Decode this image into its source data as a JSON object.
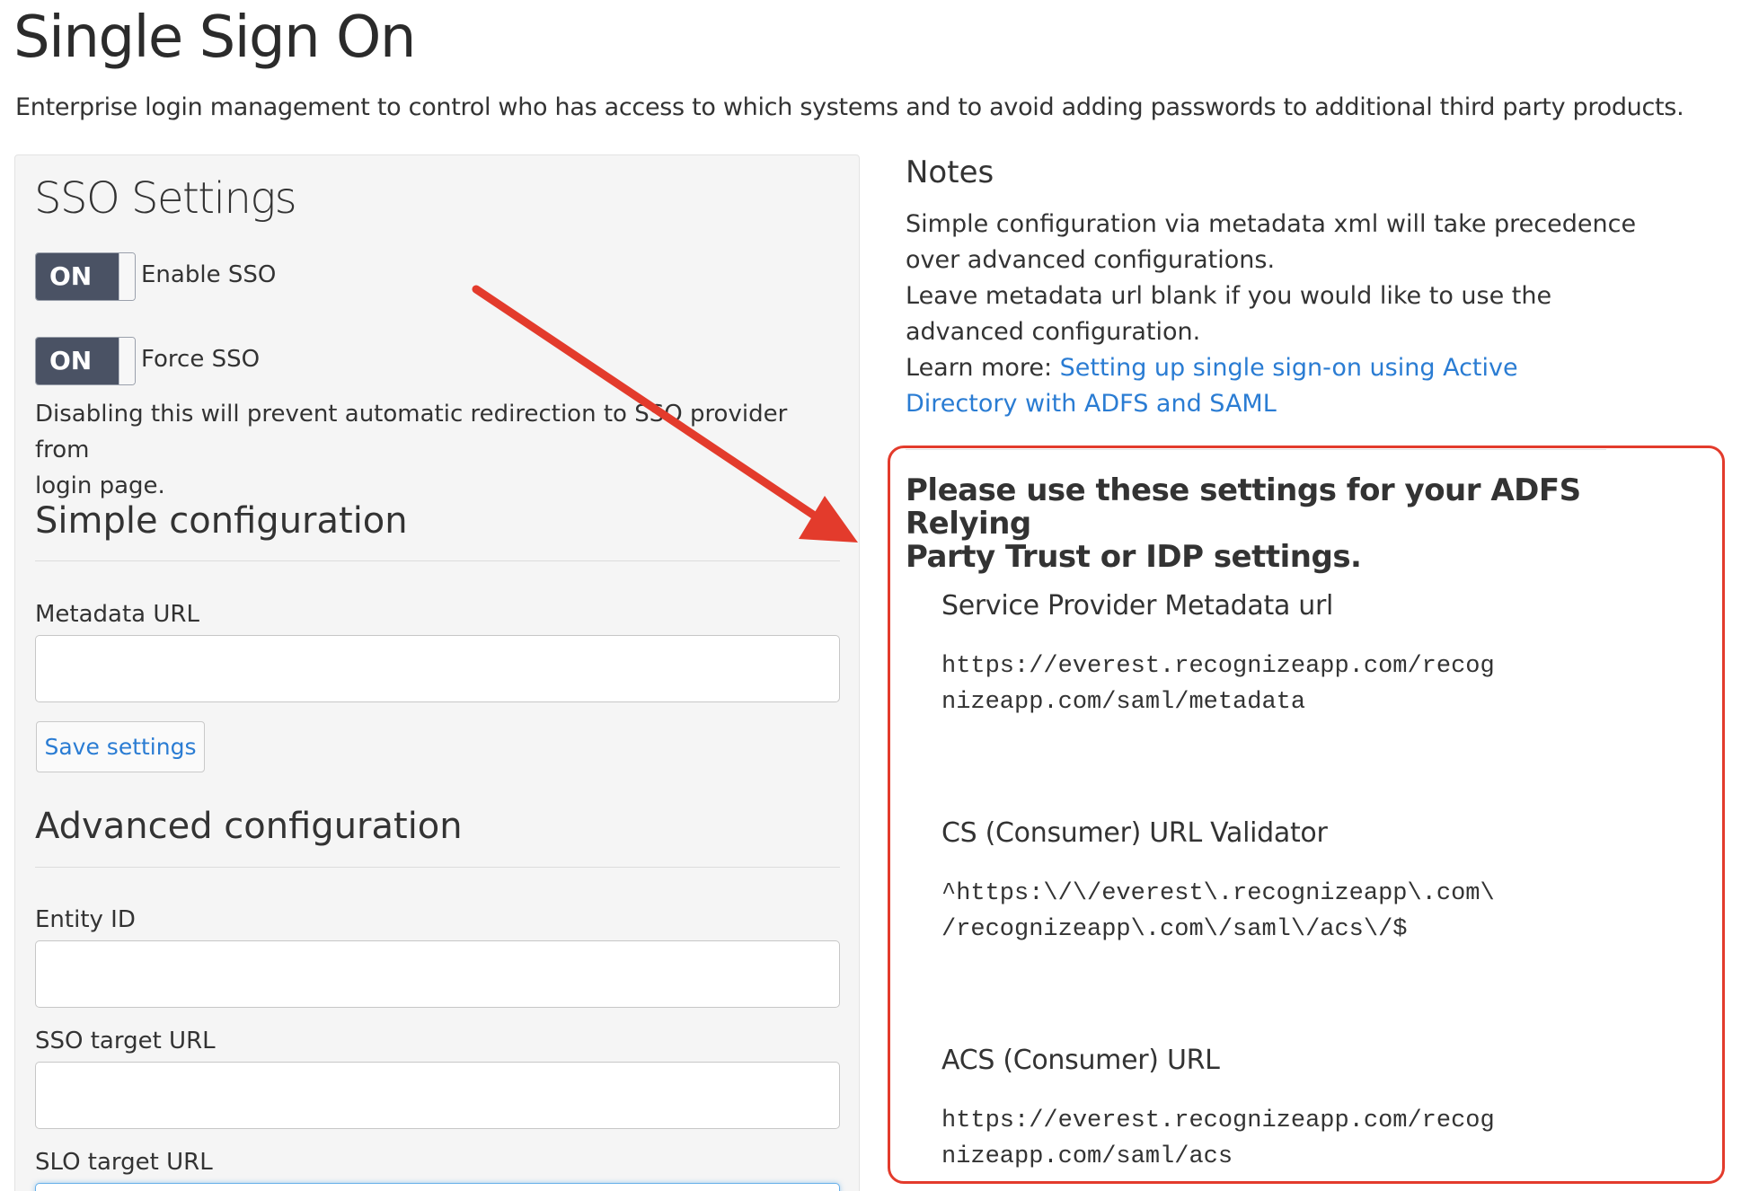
{
  "page": {
    "title": "Single Sign On",
    "subtitle": "Enterprise login management to control who has access to which systems and to avoid adding passwords to additional third party products."
  },
  "sso_settings": {
    "title": "SSO Settings",
    "toggles": [
      {
        "state_label": "ON",
        "label": "Enable SSO",
        "enabled": true
      },
      {
        "state_label": "ON",
        "label": "Force SSO",
        "enabled": true
      }
    ],
    "force_sso_help_lines": [
      "Disabling this will prevent automatic redirection to SSO provider from",
      "login page."
    ]
  },
  "simple_configuration": {
    "heading": "Simple configuration",
    "metadata_url_label": "Metadata URL",
    "metadata_url_value": "",
    "save_button_label": "Save settings"
  },
  "advanced_configuration": {
    "heading": "Advanced configuration",
    "entity_id_label": "Entity ID",
    "entity_id_value": "",
    "sso_target_url_label": "SSO target URL",
    "sso_target_url_value": "",
    "slo_target_url_label": "SLO target URL",
    "slo_target_url_value": ""
  },
  "notes": {
    "title": "Notes",
    "lines": [
      "Simple configuration via metadata xml will take precedence",
      "over advanced configurations.",
      "Leave metadata url blank if you would like to use the",
      "advanced configuration."
    ],
    "learn_more_prefix": "Learn more: ",
    "learn_more_link_line1": "Setting up single sign-on using Active",
    "learn_more_link_line2": "Directory with ADFS and SAML"
  },
  "adfs_settings": {
    "heading_line1": "Please use these settings for your ADFS Relying",
    "heading_line2": "Party Trust or IDP settings.",
    "items": [
      {
        "label": "Service Provider Metadata url",
        "value_line1": "https://everest.recognizeapp.com/recog",
        "value_line2": "nizeapp.com/saml/metadata"
      },
      {
        "label": "CS (Consumer) URL Validator",
        "value_line1": "^https:\\/\\/everest\\.recognizeapp\\.com\\",
        "value_line2": "/recognizeapp\\.com\\/saml\\/acs\\/$"
      },
      {
        "label": "ACS (Consumer) URL",
        "value_line1": "https://everest.recognizeapp.com/recog",
        "value_line2": "nizeapp.com/saml/acs"
      }
    ]
  },
  "colors": {
    "toggle_on": "#4a5264",
    "link": "#2a7cd3",
    "annotation_red": "#e33b2c"
  }
}
